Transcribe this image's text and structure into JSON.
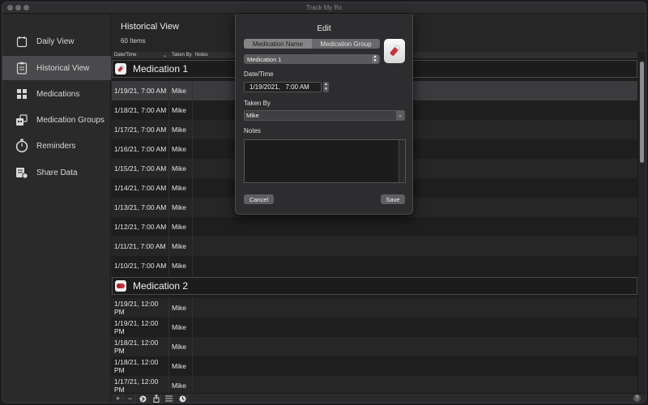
{
  "app": {
    "title": "Track My Rx"
  },
  "sidebar": {
    "items": [
      {
        "label": "Daily View",
        "icon": "calendar-icon"
      },
      {
        "label": "Historical View",
        "icon": "clipboard-icon",
        "active": true
      },
      {
        "label": "Medications",
        "icon": "grid-icon"
      },
      {
        "label": "Medication Groups",
        "icon": "medication-groups-icon"
      },
      {
        "label": "Reminders",
        "icon": "stopwatch-icon"
      },
      {
        "label": "Share Data",
        "icon": "share-data-icon"
      }
    ]
  },
  "main": {
    "title": "Historical View",
    "count": "60 Items",
    "columns": {
      "date": "Date/Time",
      "by": "Taken By",
      "notes": "Notes"
    },
    "groups": [
      {
        "name": "Medication 1",
        "icon": "pill-bottle-icon",
        "rows": [
          {
            "date": "1/19/21, 7:00 AM",
            "by": "Mike",
            "notes": ""
          },
          {
            "date": "1/18/21, 7:00 AM",
            "by": "Mike",
            "notes": ""
          },
          {
            "date": "1/17/21, 7:00 AM",
            "by": "Mike",
            "notes": ""
          },
          {
            "date": "1/16/21, 7:00 AM",
            "by": "Mike",
            "notes": ""
          },
          {
            "date": "1/15/21, 7:00 AM",
            "by": "Mike",
            "notes": ""
          },
          {
            "date": "1/14/21, 7:00 AM",
            "by": "Mike",
            "notes": ""
          },
          {
            "date": "1/13/21, 7:00 AM",
            "by": "Mike",
            "notes": ""
          },
          {
            "date": "1/12/21, 7:00 AM",
            "by": "Mike",
            "notes": ""
          },
          {
            "date": "1/11/21, 7:00 AM",
            "by": "Mike",
            "notes": ""
          },
          {
            "date": "1/10/21, 7:00 AM",
            "by": "Mike",
            "notes": ""
          }
        ]
      },
      {
        "name": "Medication 2",
        "icon": "capsule-icon",
        "rows": [
          {
            "date": "1/19/21, 12:00 PM",
            "by": "Mike",
            "notes": ""
          },
          {
            "date": "1/19/21, 12:00 PM",
            "by": "Mike",
            "notes": ""
          },
          {
            "date": "1/18/21, 12:00 PM",
            "by": "Mike",
            "notes": ""
          },
          {
            "date": "1/18/21, 12:00 PM",
            "by": "Mike",
            "notes": ""
          },
          {
            "date": "1/17/21, 12:00 PM",
            "by": "Mike",
            "notes": ""
          }
        ]
      }
    ]
  },
  "bottom_toolbar": {
    "buttons": [
      {
        "label": "+",
        "icon": "add-icon"
      },
      {
        "label": "−",
        "icon": "remove-icon"
      },
      {
        "label": "",
        "icon": "forward-circle-icon"
      },
      {
        "label": "",
        "icon": "share-icon"
      },
      {
        "label": "",
        "icon": "list-icon"
      },
      {
        "label": "",
        "icon": "clock-circle-icon"
      }
    ],
    "help": "?"
  },
  "dialog": {
    "title": "Edit",
    "segments": [
      "Medication Name",
      "Medication Group"
    ],
    "selected_segment": 0,
    "medication": "Medication 1",
    "date_label": "Date/Time",
    "date_value": "1/19/2021,   7:00 AM",
    "taken_by_label": "Taken By",
    "taken_by_value": "Mike",
    "notes_label": "Notes",
    "notes_value": "",
    "cancel": "Cancel",
    "save": "Save"
  },
  "colors": {
    "sidebar_active": "#4a4a4d",
    "row_selected": "#3b3b3e",
    "window_bg": "#262627",
    "dialog_bg": "#2d2d2f"
  }
}
